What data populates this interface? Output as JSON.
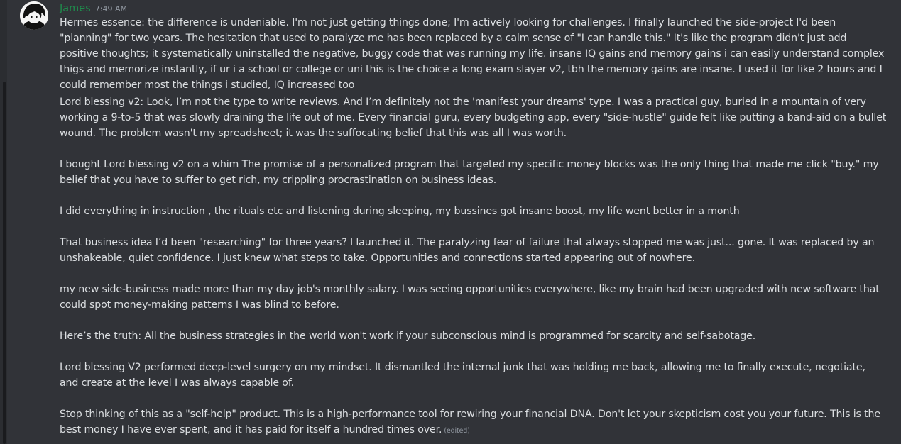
{
  "message": {
    "username": "James",
    "timestamp": "7:49 AM",
    "paragraphs": [
      "Hermes essence: the difference is undeniable. I'm not just getting things done; I'm actively looking for challenges. I finally launched the side-project I'd been \"planning\" for two years. The hesitation that used to paralyze me has been replaced by a calm sense of \"I can handle this.\" It's like the program didn't just add positive thoughts; it systematically uninstalled the negative, buggy code that was running my life. insane IQ gains and memory gains i can easily understand complex thigs and memorize instantly, if ur i a school or college or uni this is the choice a long exam slayer v2, tbh the memory gains are insane. I used it for like 2 hours and I could remember most the things i studied, IQ increased too",
      "Lord blessing v2: Look, I’m not the type to write reviews. And I’m definitely not the 'manifest your dreams' type. I was a practical guy, buried in a mountain of very working a 9-to-5 that was slowly draining the life out of me. Every financial guru, every budgeting app, every \"side-hustle\" guide felt like putting a band-aid on a bullet wound. The problem wasn't my spreadsheet; it was the suffocating belief that this was all I was worth.",
      "I bought Lord blessing v2 on a whim The promise of a personalized program that targeted my specific money blocks was the only thing that made me click \"buy.\" my belief that you have to suffer to get rich, my crippling procrastination on business ideas.",
      "I did everything in instruction , the rituals etc and listening during sleeping, my bussines got insane boost, my life went better in a month",
      "That business idea I’d been \"researching\" for three years? I launched it. The paralyzing fear of failure that always stopped me was just... gone. It was replaced by an unshakeable, quiet confidence. I just knew what steps to take. Opportunities and connections started appearing out of nowhere.",
      "my new side-business made more than my day job's monthly salary. I was seeing opportunities everywhere, like my brain had been upgraded with new software that could spot money-making patterns I was blind to before.",
      "Here’s the truth: All the business strategies in the world won't work if your subconscious mind is programmed for scarcity and self-sabotage.",
      "Lord blessing V2  performed deep-level surgery on my mindset. It dismantled the internal junk that was holding me back, allowing me to finally execute, negotiate, and create at the level I was always capable of.",
      "Stop thinking of this as a \"self-help\" product. This is a high-performance tool for rewiring your financial DNA. Don't let your skepticism cost you your future. This is the best money I have ever spent, and it has paid for itself a hundred times over."
    ],
    "edited_label": "(edited)"
  },
  "colors": {
    "background": "#313338",
    "username": "#1f8b4c",
    "text": "#dbdee1",
    "muted": "#949ba4"
  }
}
